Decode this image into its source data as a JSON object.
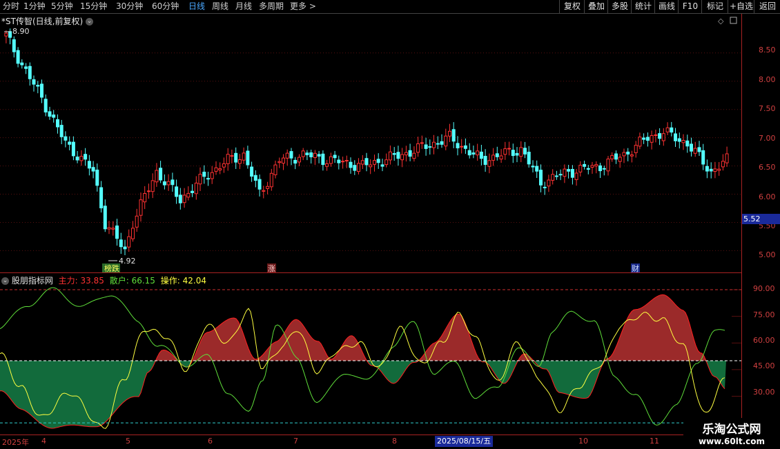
{
  "topbar": {
    "periods": [
      "分时",
      "1分钟",
      "5分钟",
      "15分钟",
      "30分钟",
      "60分钟",
      "日线",
      "周线",
      "月线",
      "多周期",
      "更多 >"
    ],
    "active_period": "日线",
    "buttons": [
      "复权",
      "叠加",
      "多股",
      "统计",
      "画线",
      "F10",
      "标记",
      "+自选",
      "返回"
    ]
  },
  "stock": {
    "title": "*ST传智(日线,前复权)",
    "high_label": "8.90",
    "low_label": "4.92",
    "current_price_tag": "5.52",
    "markers": [
      "榜跌",
      "涨",
      "财"
    ]
  },
  "price_axis": {
    "labels": [
      "8.50",
      "8.00",
      "7.50",
      "7.00",
      "6.50",
      "6.00",
      "5.50",
      "5.00"
    ]
  },
  "indicator": {
    "name": "股朋指标网",
    "main_label": "主力: 33.85",
    "retail_label": "散户: 66.15",
    "op_label": "操作: 42.04",
    "axis_labels": [
      "90.00",
      "75.00",
      "60.00",
      "45.00",
      "30.00"
    ]
  },
  "date_axis": {
    "labels": [
      "2025年",
      "4",
      "5",
      "6",
      "7",
      "8",
      "10",
      "11"
    ],
    "highlight": "2025/08/15/五"
  },
  "watermark": {
    "title": "乐淘公式网",
    "url": "www.60lt.com"
  },
  "colors": {
    "up": "#ff3232",
    "down": "#54ffff",
    "retail_line": "#5fdf3a",
    "op_line": "#ffff40",
    "fill_red": "#9b2a2a",
    "fill_green": "#126b3c",
    "axis": "#aa2222"
  }
}
